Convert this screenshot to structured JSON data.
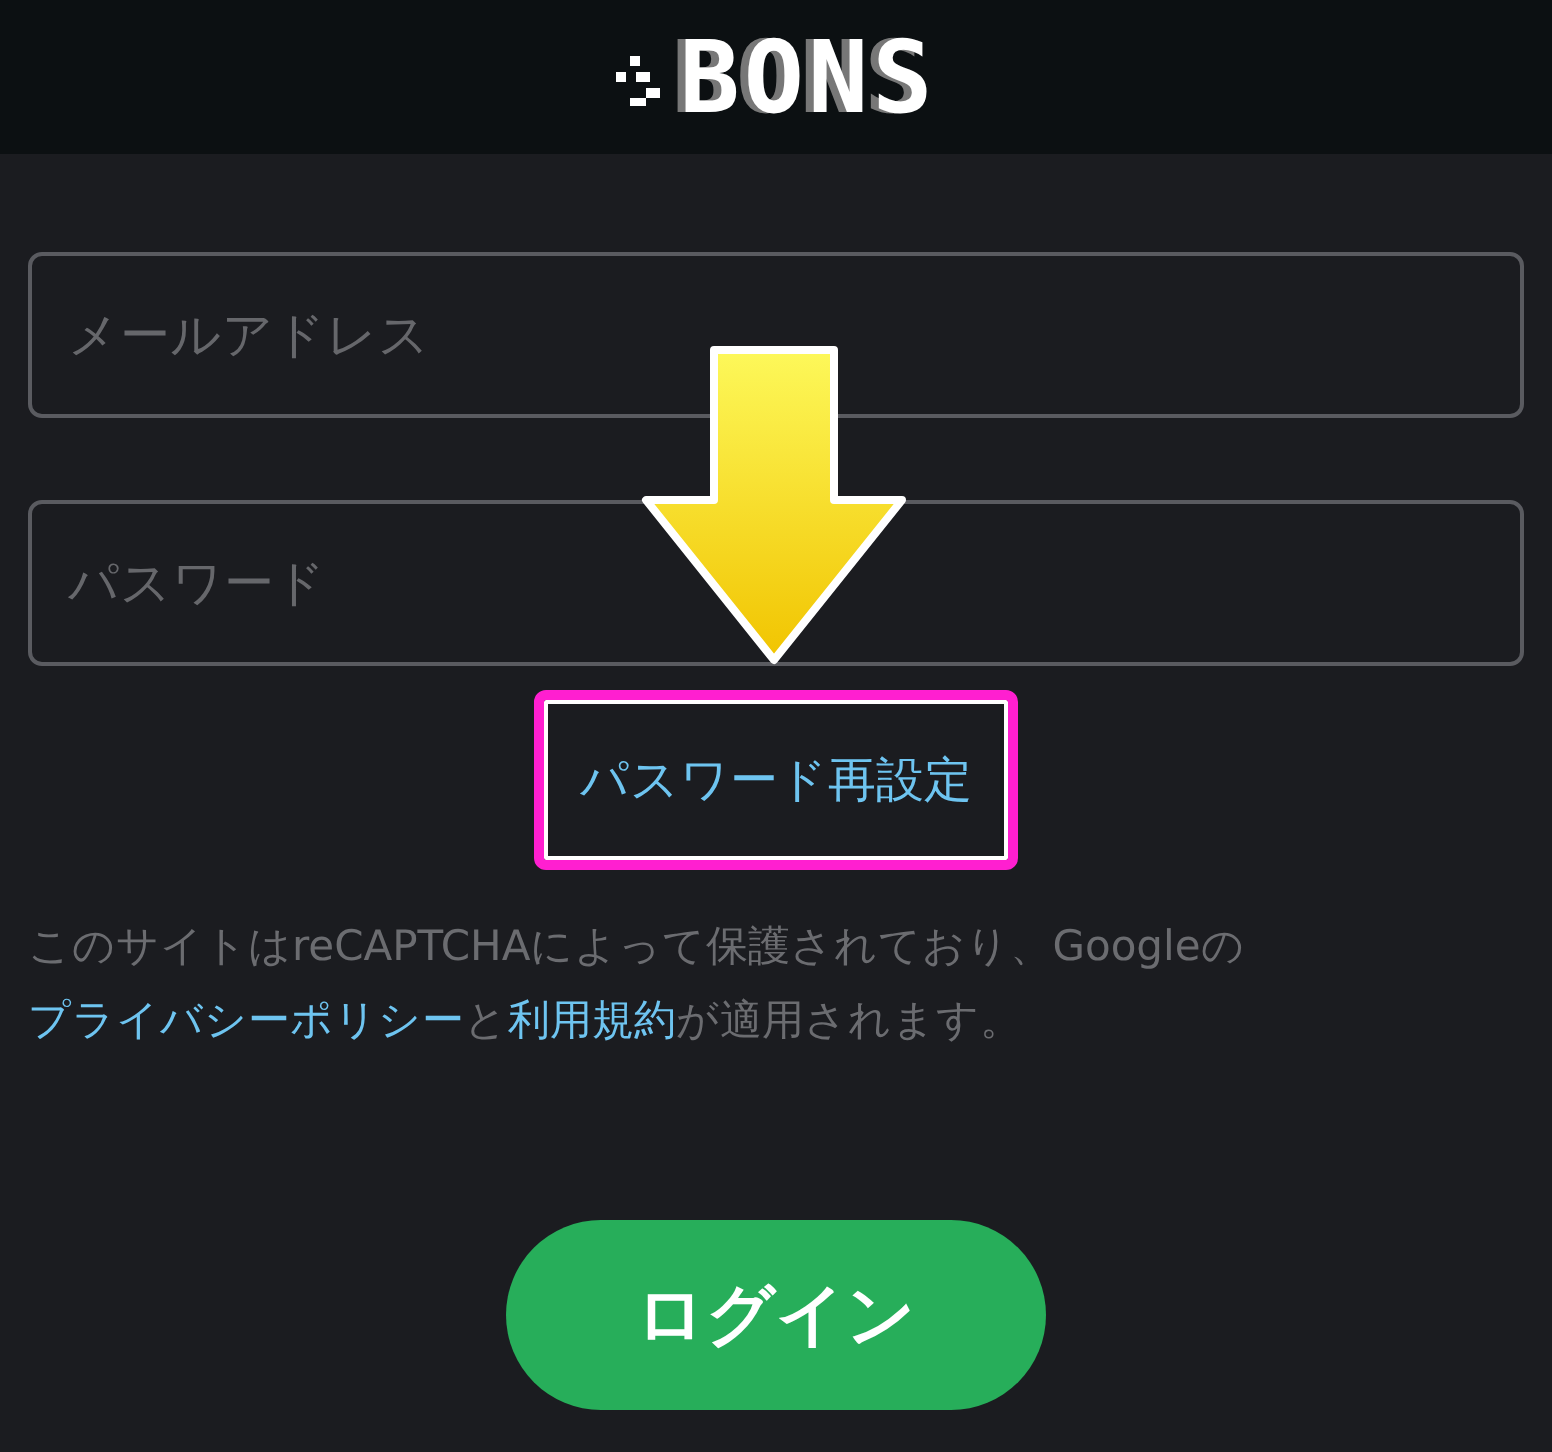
{
  "header": {
    "logo": "BONS"
  },
  "fields": [
    {
      "placeholder": "メールアドレス"
    },
    {
      "placeholder": "パスワード"
    }
  ],
  "reset_link": {
    "label": "パスワード再設定",
    "highlighted": true
  },
  "notice": {
    "before": "このサイトはreCAPTCHAによって保護されており、Googleの",
    "link_1": "プライバシーポリシー",
    "middle": "と",
    "link_2": "利用規約",
    "after": "が適用されます。"
  },
  "login_button": "ログイン"
}
